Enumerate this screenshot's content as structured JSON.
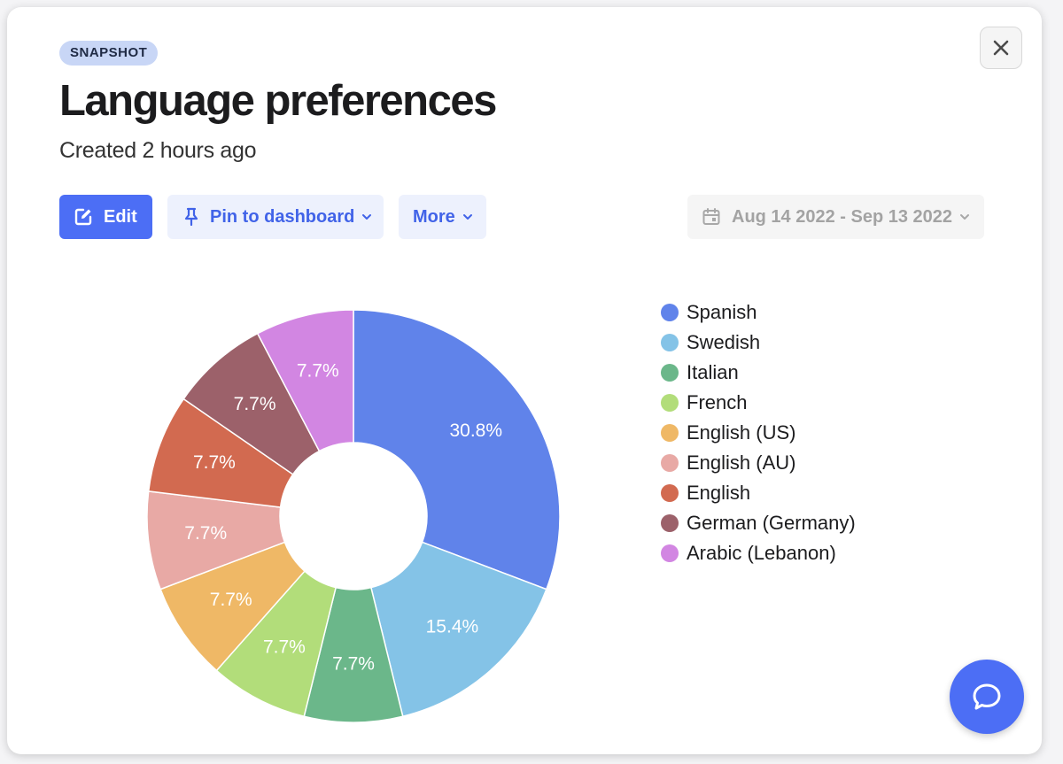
{
  "badge": "SNAPSHOT",
  "title": "Language preferences",
  "subtitle": "Created 2 hours ago",
  "toolbar": {
    "edit_label": "Edit",
    "pin_label": "Pin to dashboard",
    "more_label": "More",
    "date_range": "Aug 14 2022 - Sep 13 2022"
  },
  "icons": {
    "close": "close-icon",
    "edit": "edit-icon",
    "pin": "pin-icon",
    "calendar": "calendar-icon",
    "chat": "chat-icon"
  },
  "colors": {
    "accent": "#4c6ef5",
    "accent_soft": "#edf1fd"
  },
  "chart_data": {
    "type": "pie",
    "donut": true,
    "labels": [
      "Spanish",
      "Swedish",
      "Italian",
      "French",
      "English (US)",
      "English (AU)",
      "English",
      "German (Germany)",
      "Arabic (Lebanon)"
    ],
    "values": [
      30.8,
      15.4,
      7.7,
      7.7,
      7.7,
      7.7,
      7.7,
      7.7,
      7.7
    ],
    "value_labels": [
      "30.8%",
      "15.4%",
      "7.7%",
      "7.7%",
      "7.7%",
      "7.7%",
      "7.7%",
      "7.7%",
      "7.7%"
    ],
    "colors": [
      "#6083ea",
      "#84c3e7",
      "#6bb78a",
      "#b2dd7a",
      "#efb866",
      "#e8a9a5",
      "#d26a50",
      "#9c616a",
      "#d286e2"
    ],
    "legend_position": "right"
  }
}
